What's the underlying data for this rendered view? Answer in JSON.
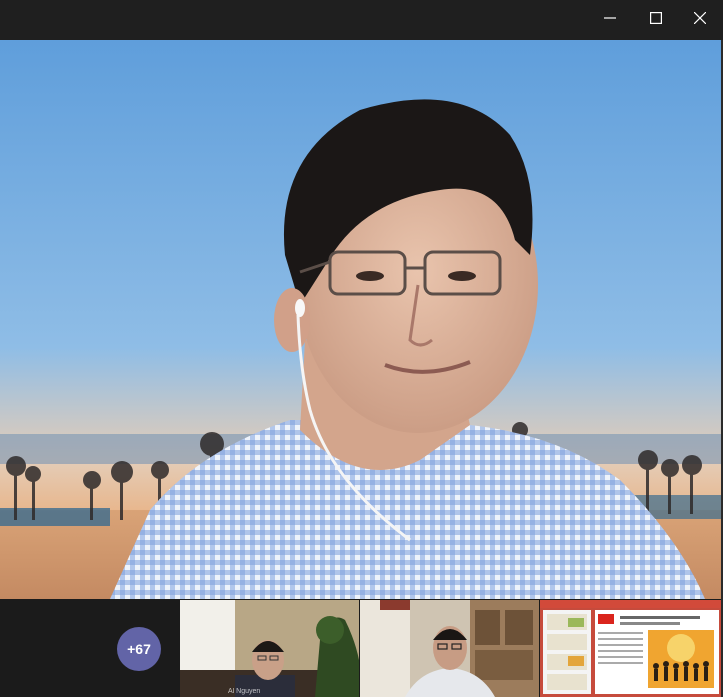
{
  "window": {
    "controls": [
      "minimize-icon",
      "maximize-icon",
      "close-icon"
    ]
  },
  "main_speaker": {
    "background": "beach-sunset-scene",
    "accent_sky": "#6aa6de"
  },
  "participants": {
    "overflow_count": "+67",
    "badge_color": "#6264a7",
    "tiles": [
      {
        "name": "Al Nguyen",
        "scene": "office-with-plant"
      },
      {
        "name": "",
        "scene": "office-with-bookshelf"
      },
      {
        "name": "",
        "scene": "shared-presentation-slide"
      }
    ]
  }
}
